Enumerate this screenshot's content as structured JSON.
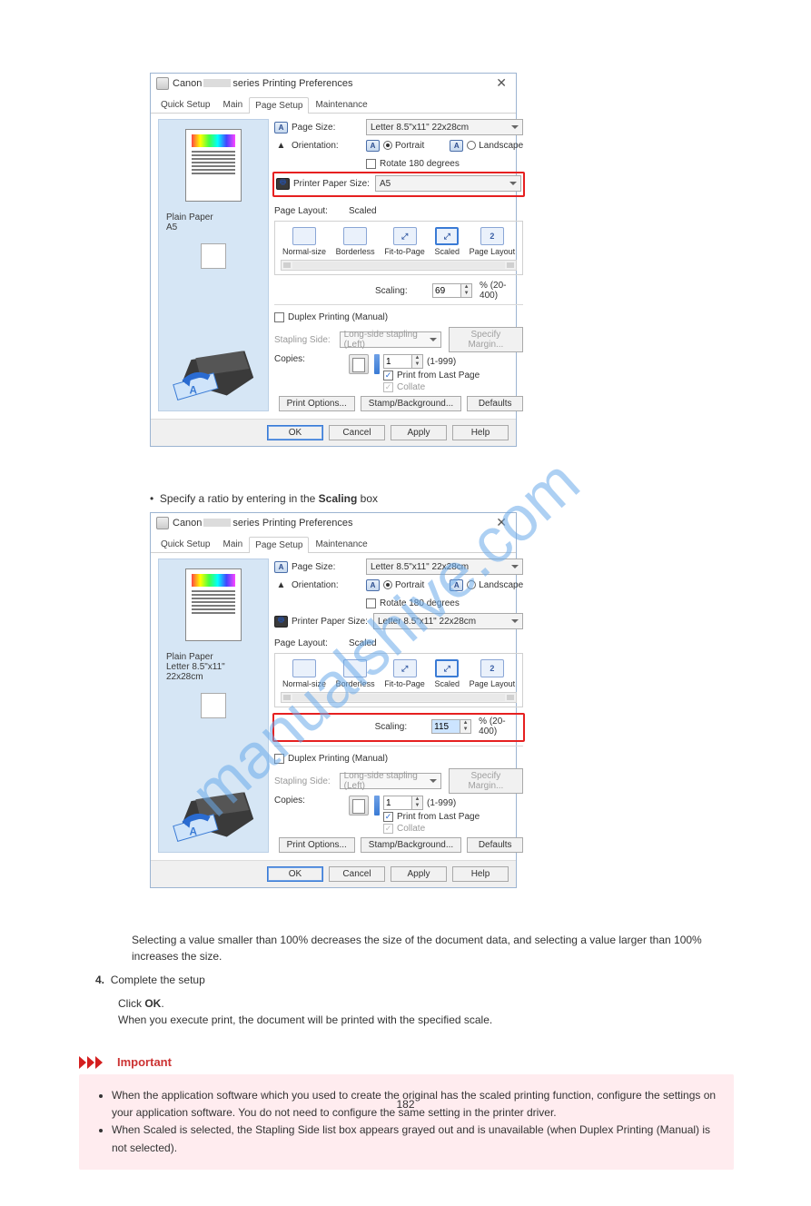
{
  "watermark": "manualshive.com",
  "page_number": "182",
  "dialog1": {
    "title_prefix": "Canon",
    "title_suffix": "series Printing Preferences",
    "tabs": {
      "quick": "Quick Setup",
      "main": "Main",
      "page": "Page Setup",
      "maint": "Maintenance"
    },
    "page_size_label": "Page Size:",
    "page_size_value": "Letter 8.5\"x11\" 22x28cm",
    "orientation_label": "Orientation:",
    "portrait": "Portrait",
    "landscape": "Landscape",
    "rotate180": "Rotate 180 degrees",
    "printer_paper_label": "Printer Paper Size:",
    "printer_paper_value": "A5",
    "media": {
      "type": "Plain Paper",
      "size": "A5"
    },
    "page_layout_label": "Page Layout:",
    "page_layout_value": "Scaled",
    "layouts": {
      "normal": "Normal-size",
      "borderless": "Borderless",
      "fit": "Fit-to-Page",
      "scaled": "Scaled",
      "pagelayout": "Page Layout",
      "pagelayout_num": "2"
    },
    "scaling_label": "Scaling:",
    "scaling_value": "69",
    "scaling_range": "% (20-400)",
    "duplex": "Duplex Printing (Manual)",
    "stapling_label": "Stapling Side:",
    "stapling_value": "Long-side stapling (Left)",
    "specify_margin": "Specify Margin...",
    "copies_label": "Copies:",
    "copies_value": "1",
    "copies_range": "(1-999)",
    "print_last": "Print from Last Page",
    "collate": "Collate",
    "print_options": "Print Options...",
    "stamp": "Stamp/Background...",
    "defaults": "Defaults",
    "ok": "OK",
    "cancel": "Cancel",
    "apply": "Apply",
    "help": "Help"
  },
  "between_text": {
    "bullet": "•",
    "line1_a": "Specify a ratio by entering in the ",
    "line1_b": "Scaling",
    "line1_c": " box"
  },
  "dialog2": {
    "title_prefix": "Canon",
    "title_suffix": "series Printing Preferences",
    "tabs": {
      "quick": "Quick Setup",
      "main": "Main",
      "page": "Page Setup",
      "maint": "Maintenance"
    },
    "page_size_label": "Page Size:",
    "page_size_value": "Letter 8.5\"x11\" 22x28cm",
    "orientation_label": "Orientation:",
    "portrait": "Portrait",
    "landscape": "Landscape",
    "rotate180": "Rotate 180 degrees",
    "printer_paper_label": "Printer Paper Size:",
    "printer_paper_value": "Letter 8.5\"x11\" 22x28cm",
    "media": {
      "type": "Plain Paper",
      "size": "Letter 8.5\"x11\" 22x28cm"
    },
    "page_layout_label": "Page Layout:",
    "page_layout_value": "Scaled",
    "layouts": {
      "normal": "Normal-size",
      "borderless": "Borderless",
      "fit": "Fit-to-Page",
      "scaled": "Scaled",
      "pagelayout": "Page Layout",
      "pagelayout_num": "2"
    },
    "scaling_label": "Scaling:",
    "scaling_value": "115",
    "scaling_range": "% (20-400)",
    "duplex": "Duplex Printing (Manual)",
    "stapling_label": "Stapling Side:",
    "stapling_value": "Long-side stapling (Left)",
    "specify_margin": "Specify Margin...",
    "copies_label": "Copies:",
    "copies_value": "1",
    "copies_range": "(1-999)",
    "print_last": "Print from Last Page",
    "collate": "Collate",
    "print_options": "Print Options...",
    "stamp": "Stamp/Background...",
    "defaults": "Defaults",
    "ok": "OK",
    "cancel": "Cancel",
    "apply": "Apply",
    "help": "Help"
  },
  "after_text": {
    "line1": "Selecting a value smaller than 100% decreases the size of the document data, and selecting a value larger than 100% increases the size.",
    "step4": "4.",
    "step4_text": "Complete the setup",
    "step4_body_a": "Click ",
    "step4_body_b": "OK",
    "step4_body_c": ".",
    "step4_body2": "When you execute print, the document will be printed with the specified scale."
  },
  "important": {
    "label": "Important",
    "bullets": [
      "When the application software which you used to create the original has the scaled printing function, configure the settings on your application software. You do not need to configure the same setting in the printer driver.",
      "When Scaled is selected, the Stapling Side list box appears grayed out and is unavailable (when Duplex Printing (Manual) is not selected)."
    ]
  }
}
